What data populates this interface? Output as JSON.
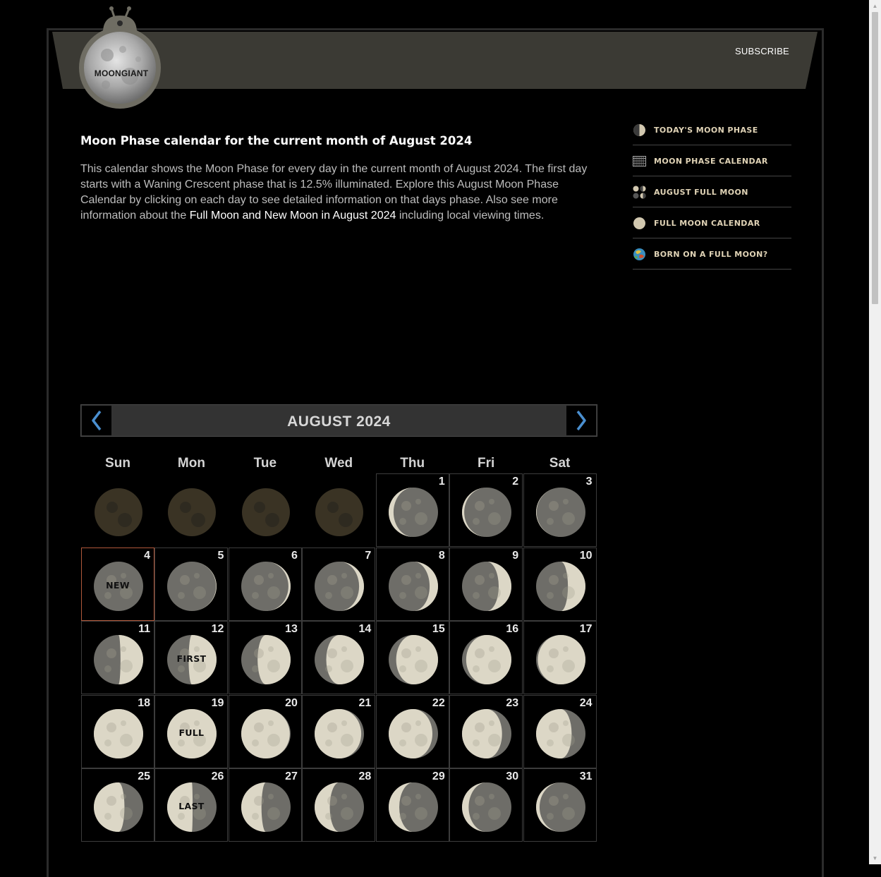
{
  "header": {
    "logo_text": "MOONGIANT",
    "subscribe": "SUBSCRIBE"
  },
  "main": {
    "title": "Moon Phase calendar for the current month of August 2024",
    "intro_text": "This calendar shows the Moon Phase for every day in the current month of August 2024. The first day starts with a Waning Crescent phase that is 12.5% illuminated. Explore this August Moon Phase Calendar by clicking on each day to see detailed information on that days phase. Also see more information about the ",
    "intro_link": "Full Moon and New Moon in August 2024",
    "intro_after": " including local viewing times."
  },
  "sidebar": {
    "items": [
      {
        "label": "TODAY'S MOON PHASE",
        "icon": "half-moon-icon"
      },
      {
        "label": "MOON PHASE CALENDAR",
        "icon": "calendar-grid-icon"
      },
      {
        "label": "AUGUST FULL MOON",
        "icon": "moon-phases-icon"
      },
      {
        "label": "FULL MOON CALENDAR",
        "icon": "full-moon-icon"
      },
      {
        "label": "BORN ON A FULL MOON?",
        "icon": "colorful-moon-icon"
      }
    ]
  },
  "calendar": {
    "month_label": "AUGUST 2024",
    "prev_icon": "chevron-left-icon",
    "next_icon": "chevron-right-icon",
    "weekdays": [
      "Sun",
      "Mon",
      "Tue",
      "Wed",
      "Thu",
      "Fri",
      "Sat"
    ],
    "leading_blanks": 4,
    "today": 4,
    "days": [
      {
        "day": "1",
        "label": ""
      },
      {
        "day": "2",
        "label": ""
      },
      {
        "day": "3",
        "label": ""
      },
      {
        "day": "4",
        "label": "NEW"
      },
      {
        "day": "5",
        "label": ""
      },
      {
        "day": "6",
        "label": ""
      },
      {
        "day": "7",
        "label": ""
      },
      {
        "day": "8",
        "label": ""
      },
      {
        "day": "9",
        "label": ""
      },
      {
        "day": "10",
        "label": ""
      },
      {
        "day": "11",
        "label": ""
      },
      {
        "day": "12",
        "label": "FIRST"
      },
      {
        "day": "13",
        "label": ""
      },
      {
        "day": "14",
        "label": ""
      },
      {
        "day": "15",
        "label": ""
      },
      {
        "day": "16",
        "label": ""
      },
      {
        "day": "17",
        "label": ""
      },
      {
        "day": "18",
        "label": ""
      },
      {
        "day": "19",
        "label": "FULL"
      },
      {
        "day": "20",
        "label": ""
      },
      {
        "day": "21",
        "label": ""
      },
      {
        "day": "22",
        "label": ""
      },
      {
        "day": "23",
        "label": ""
      },
      {
        "day": "24",
        "label": ""
      },
      {
        "day": "25",
        "label": ""
      },
      {
        "day": "26",
        "label": "LAST"
      },
      {
        "day": "27",
        "label": ""
      },
      {
        "day": "28",
        "label": ""
      },
      {
        "day": "29",
        "label": ""
      },
      {
        "day": "30",
        "label": ""
      },
      {
        "day": "31",
        "label": ""
      }
    ]
  },
  "colors": {
    "accent_today_border": "#b0583a",
    "nav_text": "#e0d3b6",
    "header_band": "#3b3a34",
    "moon_lit": "#d9d4c3",
    "moon_dark": "#6b6a66"
  }
}
